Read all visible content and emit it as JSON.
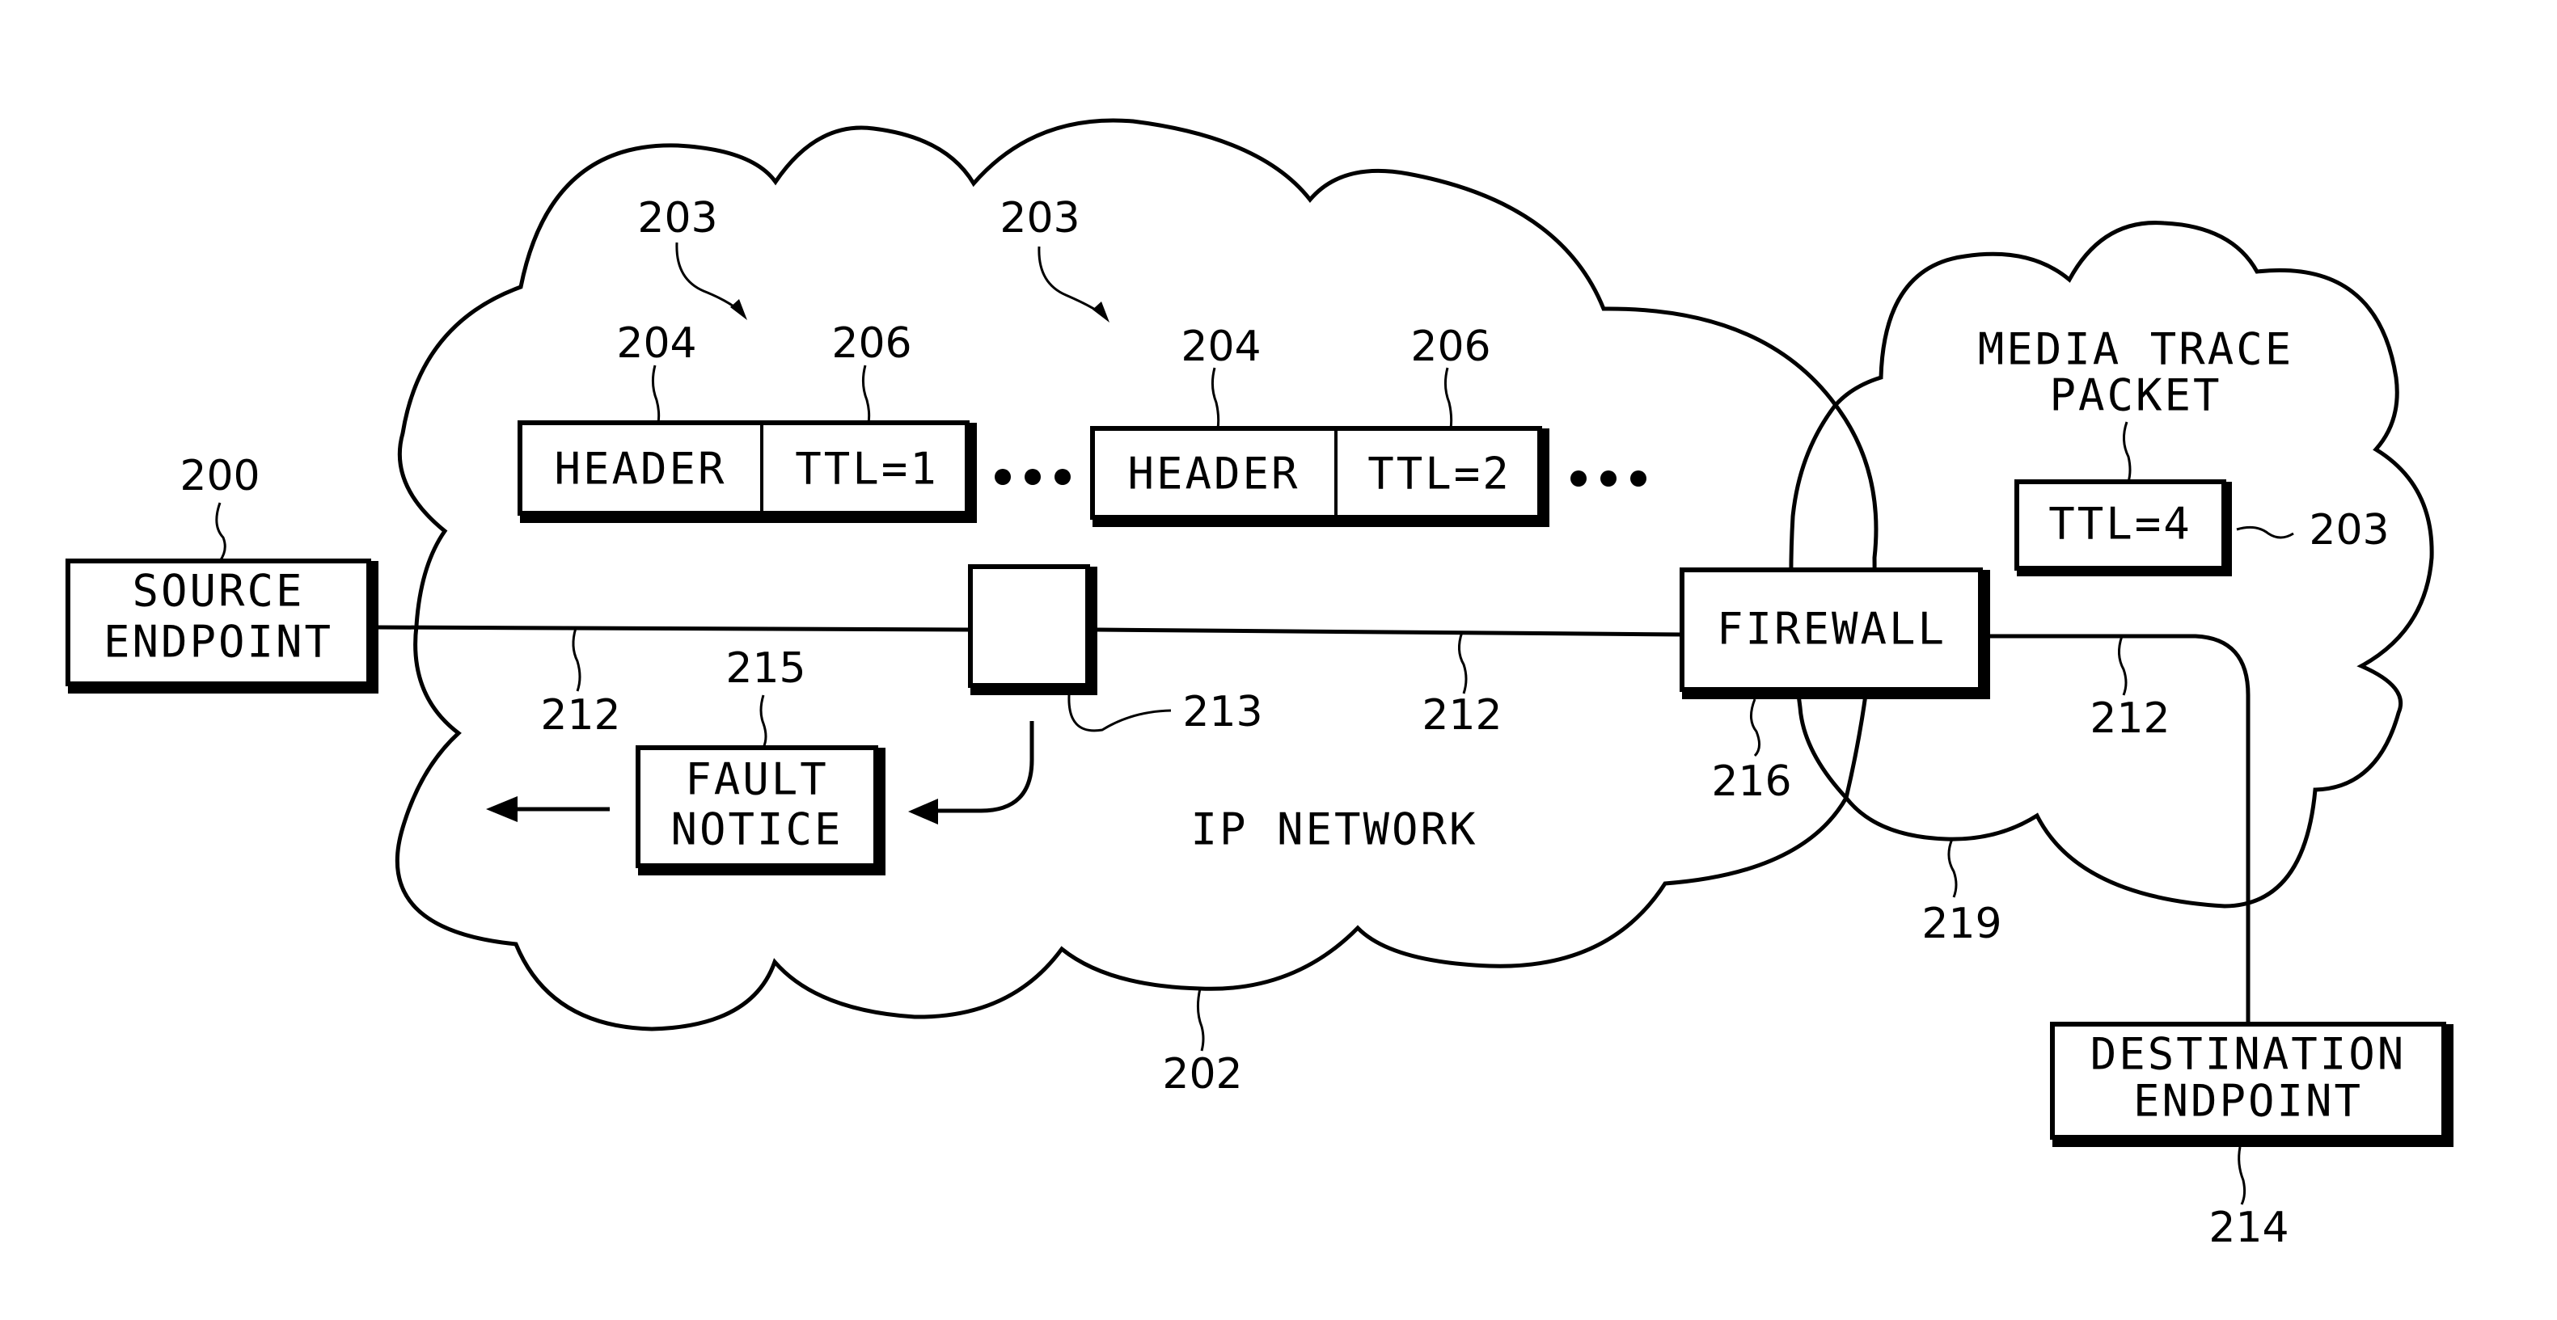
{
  "figure": {
    "type": "network diagram",
    "nodes": {
      "source_endpoint": {
        "line1": "SOURCE",
        "line2": "ENDPOINT",
        "ref": "200"
      },
      "router": {
        "ref": "213"
      },
      "firewall": {
        "label": "FIREWALL",
        "ref": "216"
      },
      "destination_endpoint": {
        "line1": "DESTINATION",
        "line2": "ENDPOINT",
        "ref": "214"
      },
      "fault_notice": {
        "line1": "FAULT",
        "line2": "NOTICE",
        "ref": "215"
      }
    },
    "networks": {
      "ip_network": {
        "label": "IP NETWORK",
        "ref": "202"
      },
      "second_network": {
        "ref": "219"
      }
    },
    "links": {
      "ref_left": "212",
      "ref_middle": "212",
      "ref_right": "212"
    },
    "packets": [
      {
        "ref": "203",
        "header_ref": "204",
        "ttl_ref": "206",
        "header": "HEADER",
        "ttl": "TTL=1"
      },
      {
        "ref": "203",
        "header_ref": "204",
        "ttl_ref": "206",
        "header": "HEADER",
        "ttl": "TTL=2"
      }
    ],
    "media_trace": {
      "line1": "MEDIA TRACE",
      "line2": "PACKET",
      "ttl": "TTL=4",
      "ref": "203"
    },
    "ellipsis": "•••"
  }
}
